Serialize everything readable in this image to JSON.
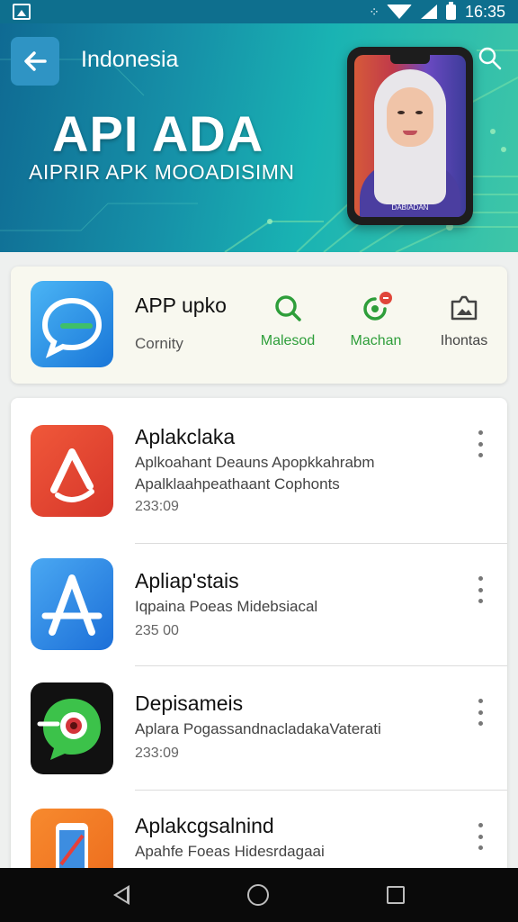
{
  "status_bar": {
    "time": "16:35",
    "icons": [
      "gallery-icon",
      "dots-icon",
      "wifi-icon",
      "signal-icon",
      "battery-icon"
    ]
  },
  "hero": {
    "country": "Indonesia",
    "title": "API ADA",
    "subtitle": "AIPRIR APK MOOADISIMN",
    "phone_caption": "DABIADAN",
    "icons": [
      "back-arrow-icon",
      "search-icon"
    ]
  },
  "featured": {
    "name": "APP upko",
    "subtitle": "Cornity",
    "actions": [
      {
        "label": "Malesod",
        "icon": "search-icon"
      },
      {
        "label": "Machan",
        "icon": "refresh-notification-icon"
      },
      {
        "label": "Ihontas",
        "icon": "image-folder-icon"
      }
    ]
  },
  "apps": [
    {
      "title": "Aplakclaka",
      "desc1": "Aplkoahant Deauns Apopkkahrabm",
      "desc2": "Apalklaahpeathaant Cophonts",
      "meta": "233:09",
      "icon": "red-arrow-app-icon"
    },
    {
      "title": "Apliap'stais",
      "desc1": "Iqpaina Poeas Midebsiacal",
      "meta": "235 00",
      "icon": "app-store-a-icon"
    },
    {
      "title": "Depisameis",
      "desc1": "Aplara PogassandnacladakaVaterati",
      "meta": "233:09",
      "icon": "green-chat-eye-icon"
    },
    {
      "title": "Aplakcgsalnind",
      "desc1": "Apahfe Foeas Hidesrdagaai",
      "icon": "orange-phone-app-icon"
    }
  ],
  "colors": {
    "hero_start": "#0f6a93",
    "hero_end": "#3fc6a7",
    "accent_green": "#2e9e3a",
    "back_button": "#2f94c4"
  }
}
